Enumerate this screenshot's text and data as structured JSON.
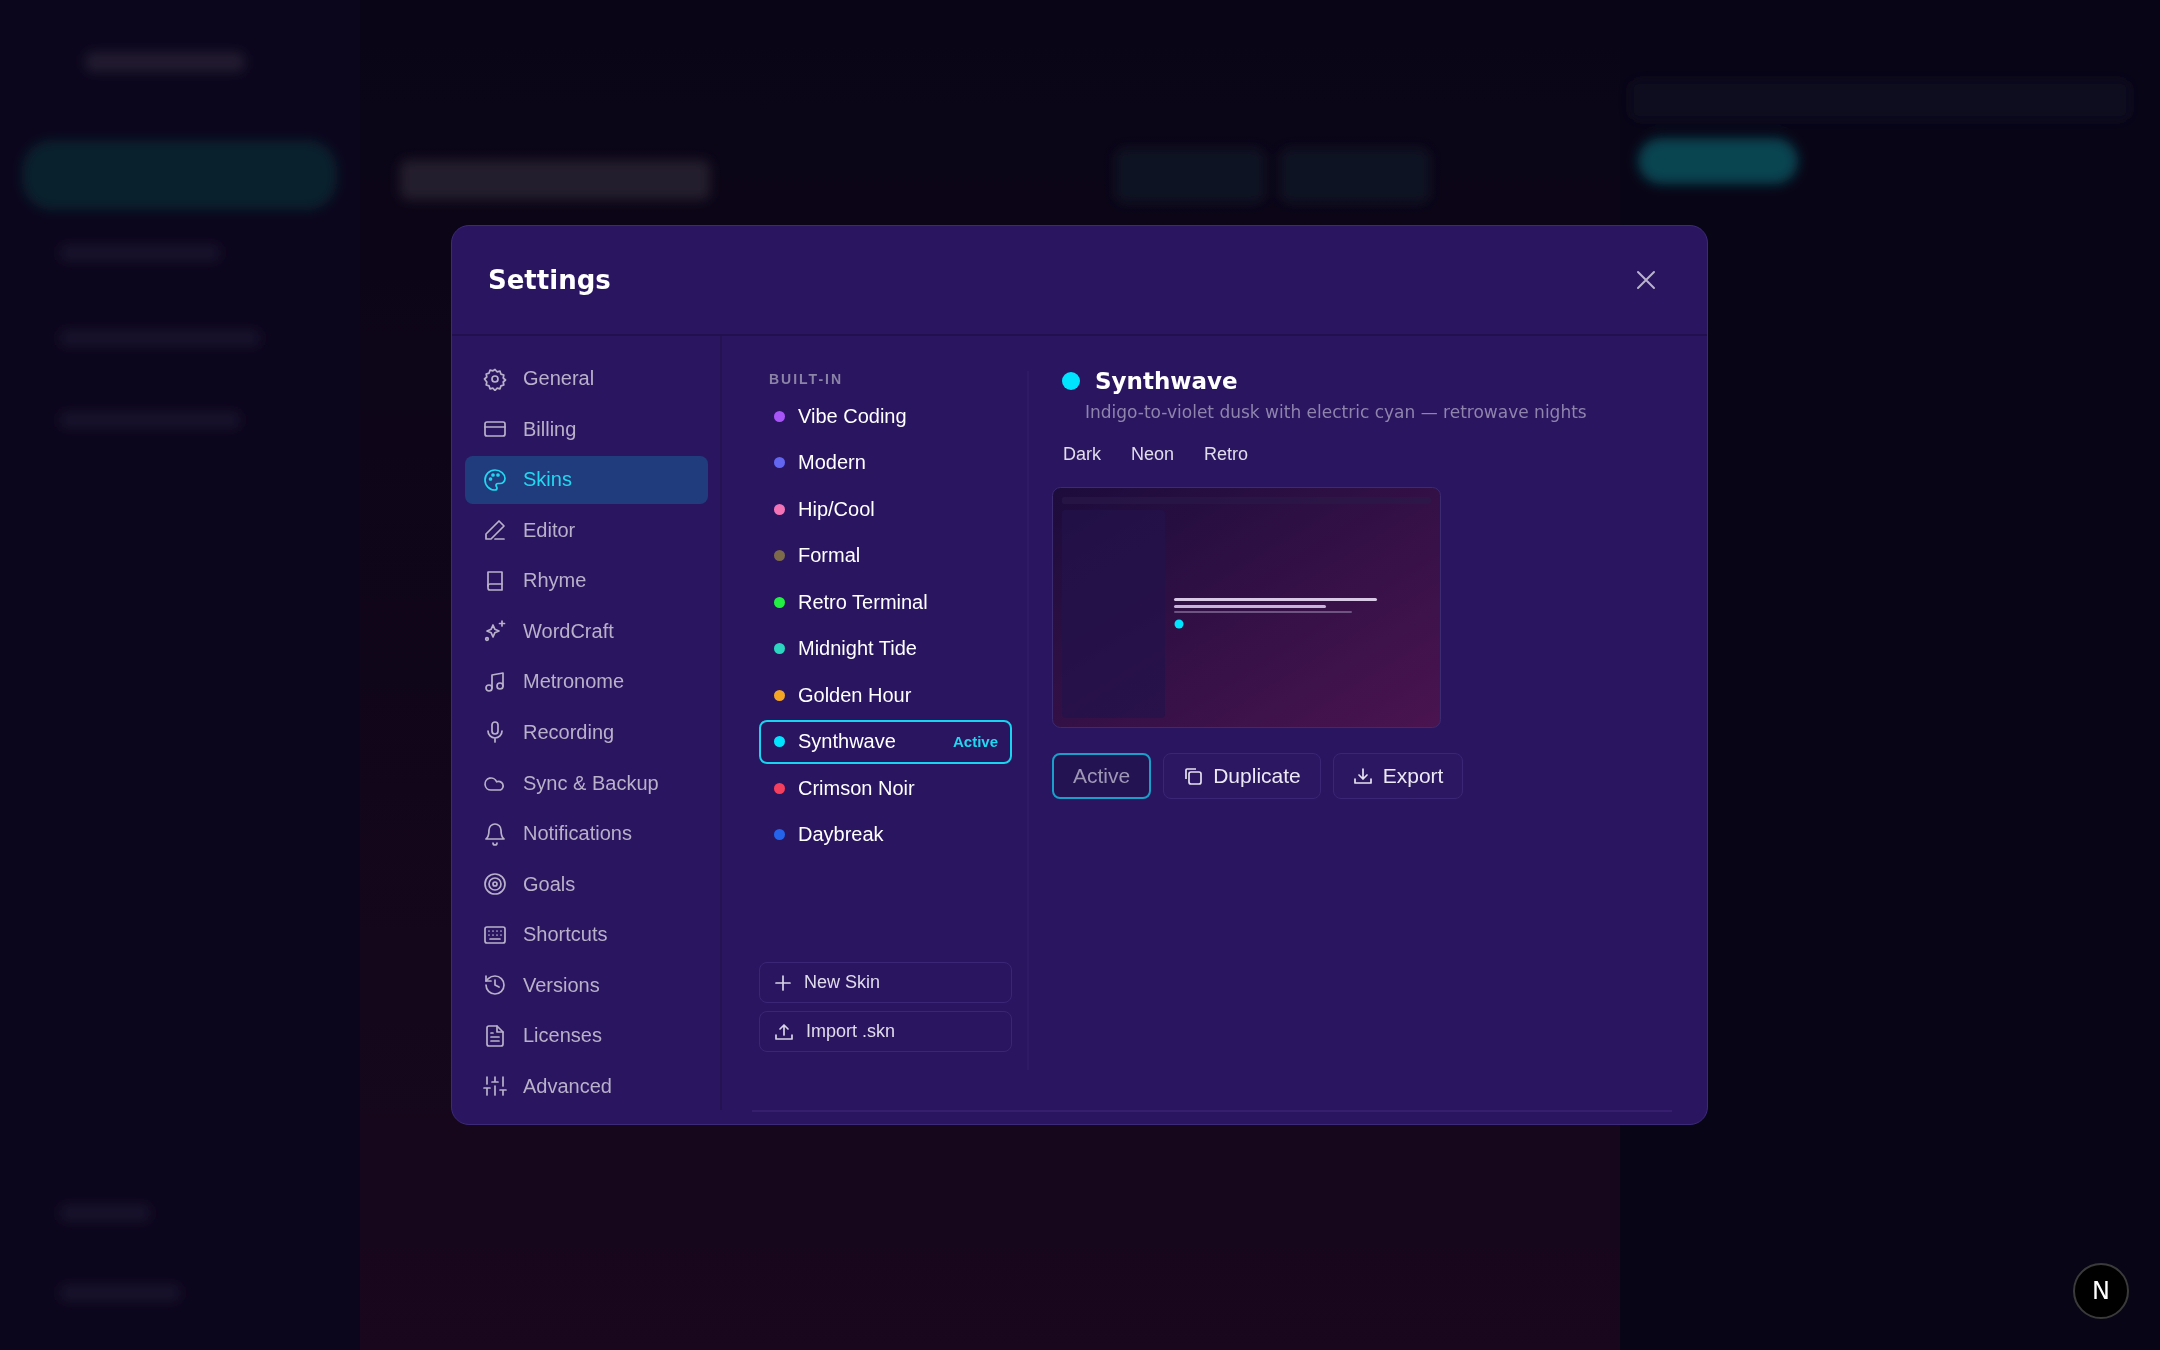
{
  "dialog": {
    "title": "Settings"
  },
  "nav": [
    {
      "label": "General",
      "selected": false
    },
    {
      "label": "Billing",
      "selected": false
    },
    {
      "label": "Skins",
      "selected": true
    },
    {
      "label": "Editor",
      "selected": false
    },
    {
      "label": "Rhyme",
      "selected": false
    },
    {
      "label": "WordCraft",
      "selected": false
    },
    {
      "label": "Metronome",
      "selected": false
    },
    {
      "label": "Recording",
      "selected": false
    },
    {
      "label": "Sync & Backup",
      "selected": false
    },
    {
      "label": "Notifications",
      "selected": false
    },
    {
      "label": "Goals",
      "selected": false
    },
    {
      "label": "Shortcuts",
      "selected": false
    },
    {
      "label": "Versions",
      "selected": false
    },
    {
      "label": "Licenses",
      "selected": false
    },
    {
      "label": "Advanced",
      "selected": false
    }
  ],
  "skins": {
    "section": "BUILT-IN",
    "items": [
      {
        "name": "Vibe Coding",
        "color": "#a855f7",
        "selected": false
      },
      {
        "name": "Modern",
        "color": "#6366f1",
        "selected": false
      },
      {
        "name": "Hip/Cool",
        "color": "#f472b6",
        "selected": false
      },
      {
        "name": "Formal",
        "color": "#7c6a4a",
        "selected": false
      },
      {
        "name": "Retro Terminal",
        "color": "#22ee44",
        "selected": false
      },
      {
        "name": "Midnight Tide",
        "color": "#2dd4bf",
        "selected": false
      },
      {
        "name": "Golden Hour",
        "color": "#f5a524",
        "selected": false
      },
      {
        "name": "Synthwave",
        "color": "#00e5ff",
        "selected": true,
        "badge": "Active"
      },
      {
        "name": "Crimson Noir",
        "color": "#f43f5e",
        "selected": false
      },
      {
        "name": "Daybreak",
        "color": "#2563eb",
        "selected": false
      }
    ],
    "actions": [
      {
        "label": "New Skin",
        "kind": "new"
      },
      {
        "label": "Import .skn",
        "kind": "import"
      }
    ]
  },
  "detail": {
    "name": "Synthwave",
    "color": "#00e5ff",
    "description": "Indigo-to-violet dusk with electric cyan — retrowave nights",
    "tags": [
      "Dark",
      "Neon",
      "Retro"
    ],
    "buttons": [
      {
        "label": "Active",
        "kind": "status"
      },
      {
        "label": "Duplicate",
        "kind": "duplicate"
      },
      {
        "label": "Export",
        "kind": "export"
      }
    ]
  },
  "corner_badge": "N"
}
